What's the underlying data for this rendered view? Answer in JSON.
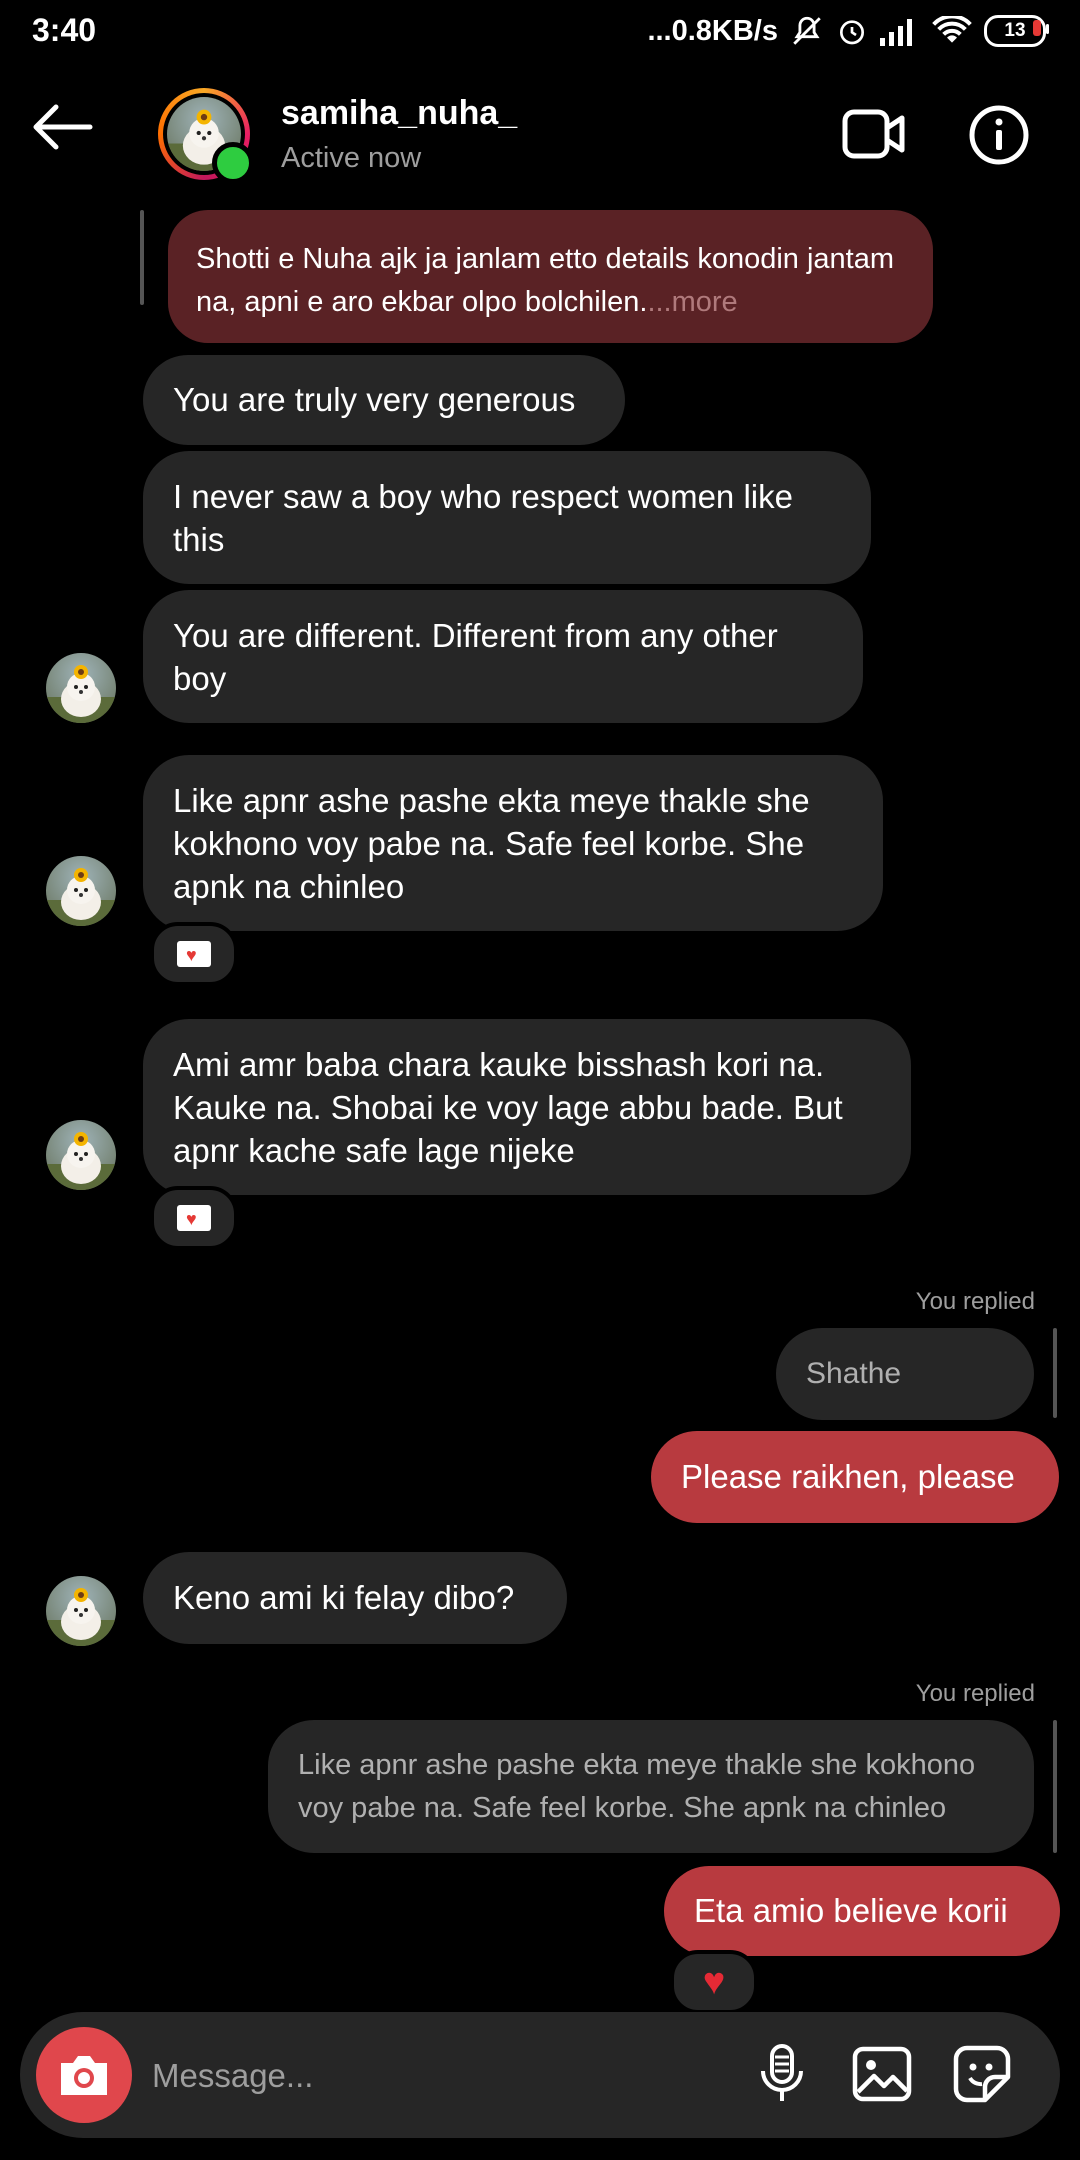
{
  "status_bar": {
    "time": "3:40",
    "network_speed": "...0.8KB/s",
    "battery": "13"
  },
  "header": {
    "username": "samiha_nuha_",
    "status": "Active now"
  },
  "messages": {
    "quoted_text": "Shotti e Nuha ajk ja janlam etto details konodin jantam na, apni e aro ekbar olpo bolchilen.",
    "quoted_more": "...more",
    "m1": "You are truly very generous",
    "m2": "I never saw a boy who respect women like this",
    "m3": "You are different. Different from any other boy",
    "m4": "Like apnr ashe pashe ekta meye thakle she kokhono voy pabe na. Safe feel korbe. She apnk na chinleo",
    "m5": "Ami amr baba chara kauke bisshash kori na. Kauke na. Shobai ke voy lage abbu bade. But apnr kache safe lage nijeke",
    "replied_label_1": "You replied",
    "replied_quote_1": "Shathe thaiken",
    "sent_1": "Please raikhen, please",
    "m6": "Keno ami ki felay dibo?",
    "replied_label_2": "You replied",
    "replied_quote_2": "Like apnr ashe pashe ekta meye thakle she kokhono voy pabe na. Safe feel korbe. She apnk na chinleo",
    "sent_2": "Eta amio believe korii"
  },
  "composer": {
    "placeholder": "Message..."
  },
  "colors": {
    "outgoing_bubble": "#b83a3f",
    "incoming_bubble": "#262626",
    "online": "#2ecc40",
    "camera": "#e0474c"
  }
}
